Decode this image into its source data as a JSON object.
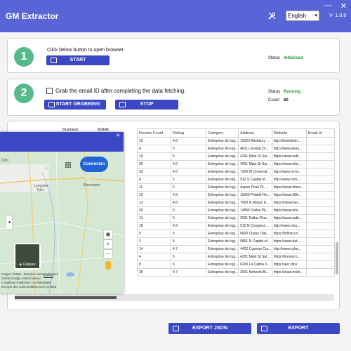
{
  "app": {
    "title": "GM Extractor",
    "version": "V- 1.0.8",
    "language": "English",
    "window_controls": [
      "—",
      "✕"
    ],
    "tools_icon": "tools-icon"
  },
  "step1": {
    "number": "1",
    "instruction": "Click below button to open browser",
    "start_label": "START",
    "status_label": "Status",
    "status_value": "Initialised"
  },
  "step2": {
    "number": "2",
    "checkbox_label": "Grab the email ID after completing the data fetching.",
    "grab_label": "START GRABBING",
    "stop_label": "STOP",
    "status_label": "Status",
    "status_value": "Running",
    "count_label": "Count",
    "count_value": "60"
  },
  "table": {
    "partial_headers": [
      "Business",
      "Mobile"
    ],
    "headers": [
      "Review Count",
      "Rating",
      "Category",
      "Address",
      "Website",
      "Email Id"
    ],
    "rows": [
      [
        "10",
        "4.6",
        "Entreprise de logi...",
        "10222 Altonbury ...",
        "http://fomfotech....",
        ""
      ],
      [
        "4",
        "5",
        "Entreprise de logi...",
        "4811 Lansing Dr,...",
        "http://www.texas...",
        ""
      ],
      [
        "10",
        "5",
        "Entreprise de logi...",
        "4201 Main St Sui...",
        "https://www.soft...",
        ""
      ],
      [
        "35",
        "4.6",
        "Entreprise de logi...",
        "4201 Main St Sui...",
        "https://www.tekr...",
        ""
      ],
      [
        "33",
        "4.6",
        "Entreprise de logi...",
        "7200 W Universit...",
        "http://www.ox-te...",
        ""
      ],
      [
        "4",
        "5",
        "Entreprise de logi...",
        "912 S Capital of ...",
        "http://www.rock...",
        ""
      ],
      [
        "11",
        "5",
        "Entreprise de logi...",
        "Aspen Peak Dr, ...",
        "https://www.fidsor...",
        ""
      ],
      [
        "10",
        "4.9",
        "Entreprise de logi...",
        "11959 Pebble Ro...",
        "https://www.38it...",
        ""
      ],
      [
        "13",
        "4.8",
        "Entreprise de logi...",
        "7000 N Mopac E...",
        "https://clearmes...",
        ""
      ],
      [
        "20",
        "5",
        "Entreprise de logi...",
        "14555 Dallas Pk...",
        "https://www.telv...",
        ""
      ],
      [
        "13",
        "5",
        "Entreprise de logi...",
        "2591 Dallas Pkw...",
        "https://www.sqlb...",
        ""
      ],
      [
        "18",
        "4.9",
        "Entreprise de logi...",
        "515 N Congress ...",
        "http://www.clou...",
        ""
      ],
      [
        "9",
        "5",
        "Entreprise de logi...",
        "6600 Chase Oak...",
        "https://txfinet.co...",
        ""
      ],
      [
        "3",
        "5",
        "Entreprise de logi...",
        "5801 N Capital of...",
        "https://www.dat...",
        ""
      ],
      [
        "14",
        "4.7",
        "Entreprise de logi...",
        "4422 Cypress Cre...",
        "http://www.cybe...",
        ""
      ],
      [
        "4",
        "5",
        "Entreprise de logi...",
        "4201 Main St Sui...",
        "https://honeyco...",
        ""
      ],
      [
        "8",
        "5",
        "Entreprise de logi...",
        "6200 La Calma D...",
        "https://uec.dev/",
        ""
      ],
      [
        "35",
        "4.7",
        "Entreprise de logi...",
        "2601 Network Bl...",
        "https://www.mobl...",
        ""
      ]
    ]
  },
  "map_popup": {
    "close": "✕",
    "connexion_label": "Connexion",
    "places": [
      "Longview",
      "Tyler",
      "Shreveport",
      "font"
    ],
    "calques_label": "Calques",
    "footer_lines": [
      "Images ©2025 , Données cartographiques",
      "©2025 Google, INEGI   Mexico",
      "Conditions d'utilisation   Confidentialité",
      "Envoyer des commentaires sur le produit"
    ],
    "scale_label": "100 km",
    "zoom_in": "+",
    "zoom_out": "−",
    "left_tab": "◂"
  },
  "footer": {
    "export_json_label": "EXPORT JSON",
    "export_label": "EXPORT"
  },
  "colors": {
    "brand": "#5865d7",
    "button": "#3b47c4",
    "step_circle": "#55b98b",
    "status_green": "#1e9a2e"
  }
}
